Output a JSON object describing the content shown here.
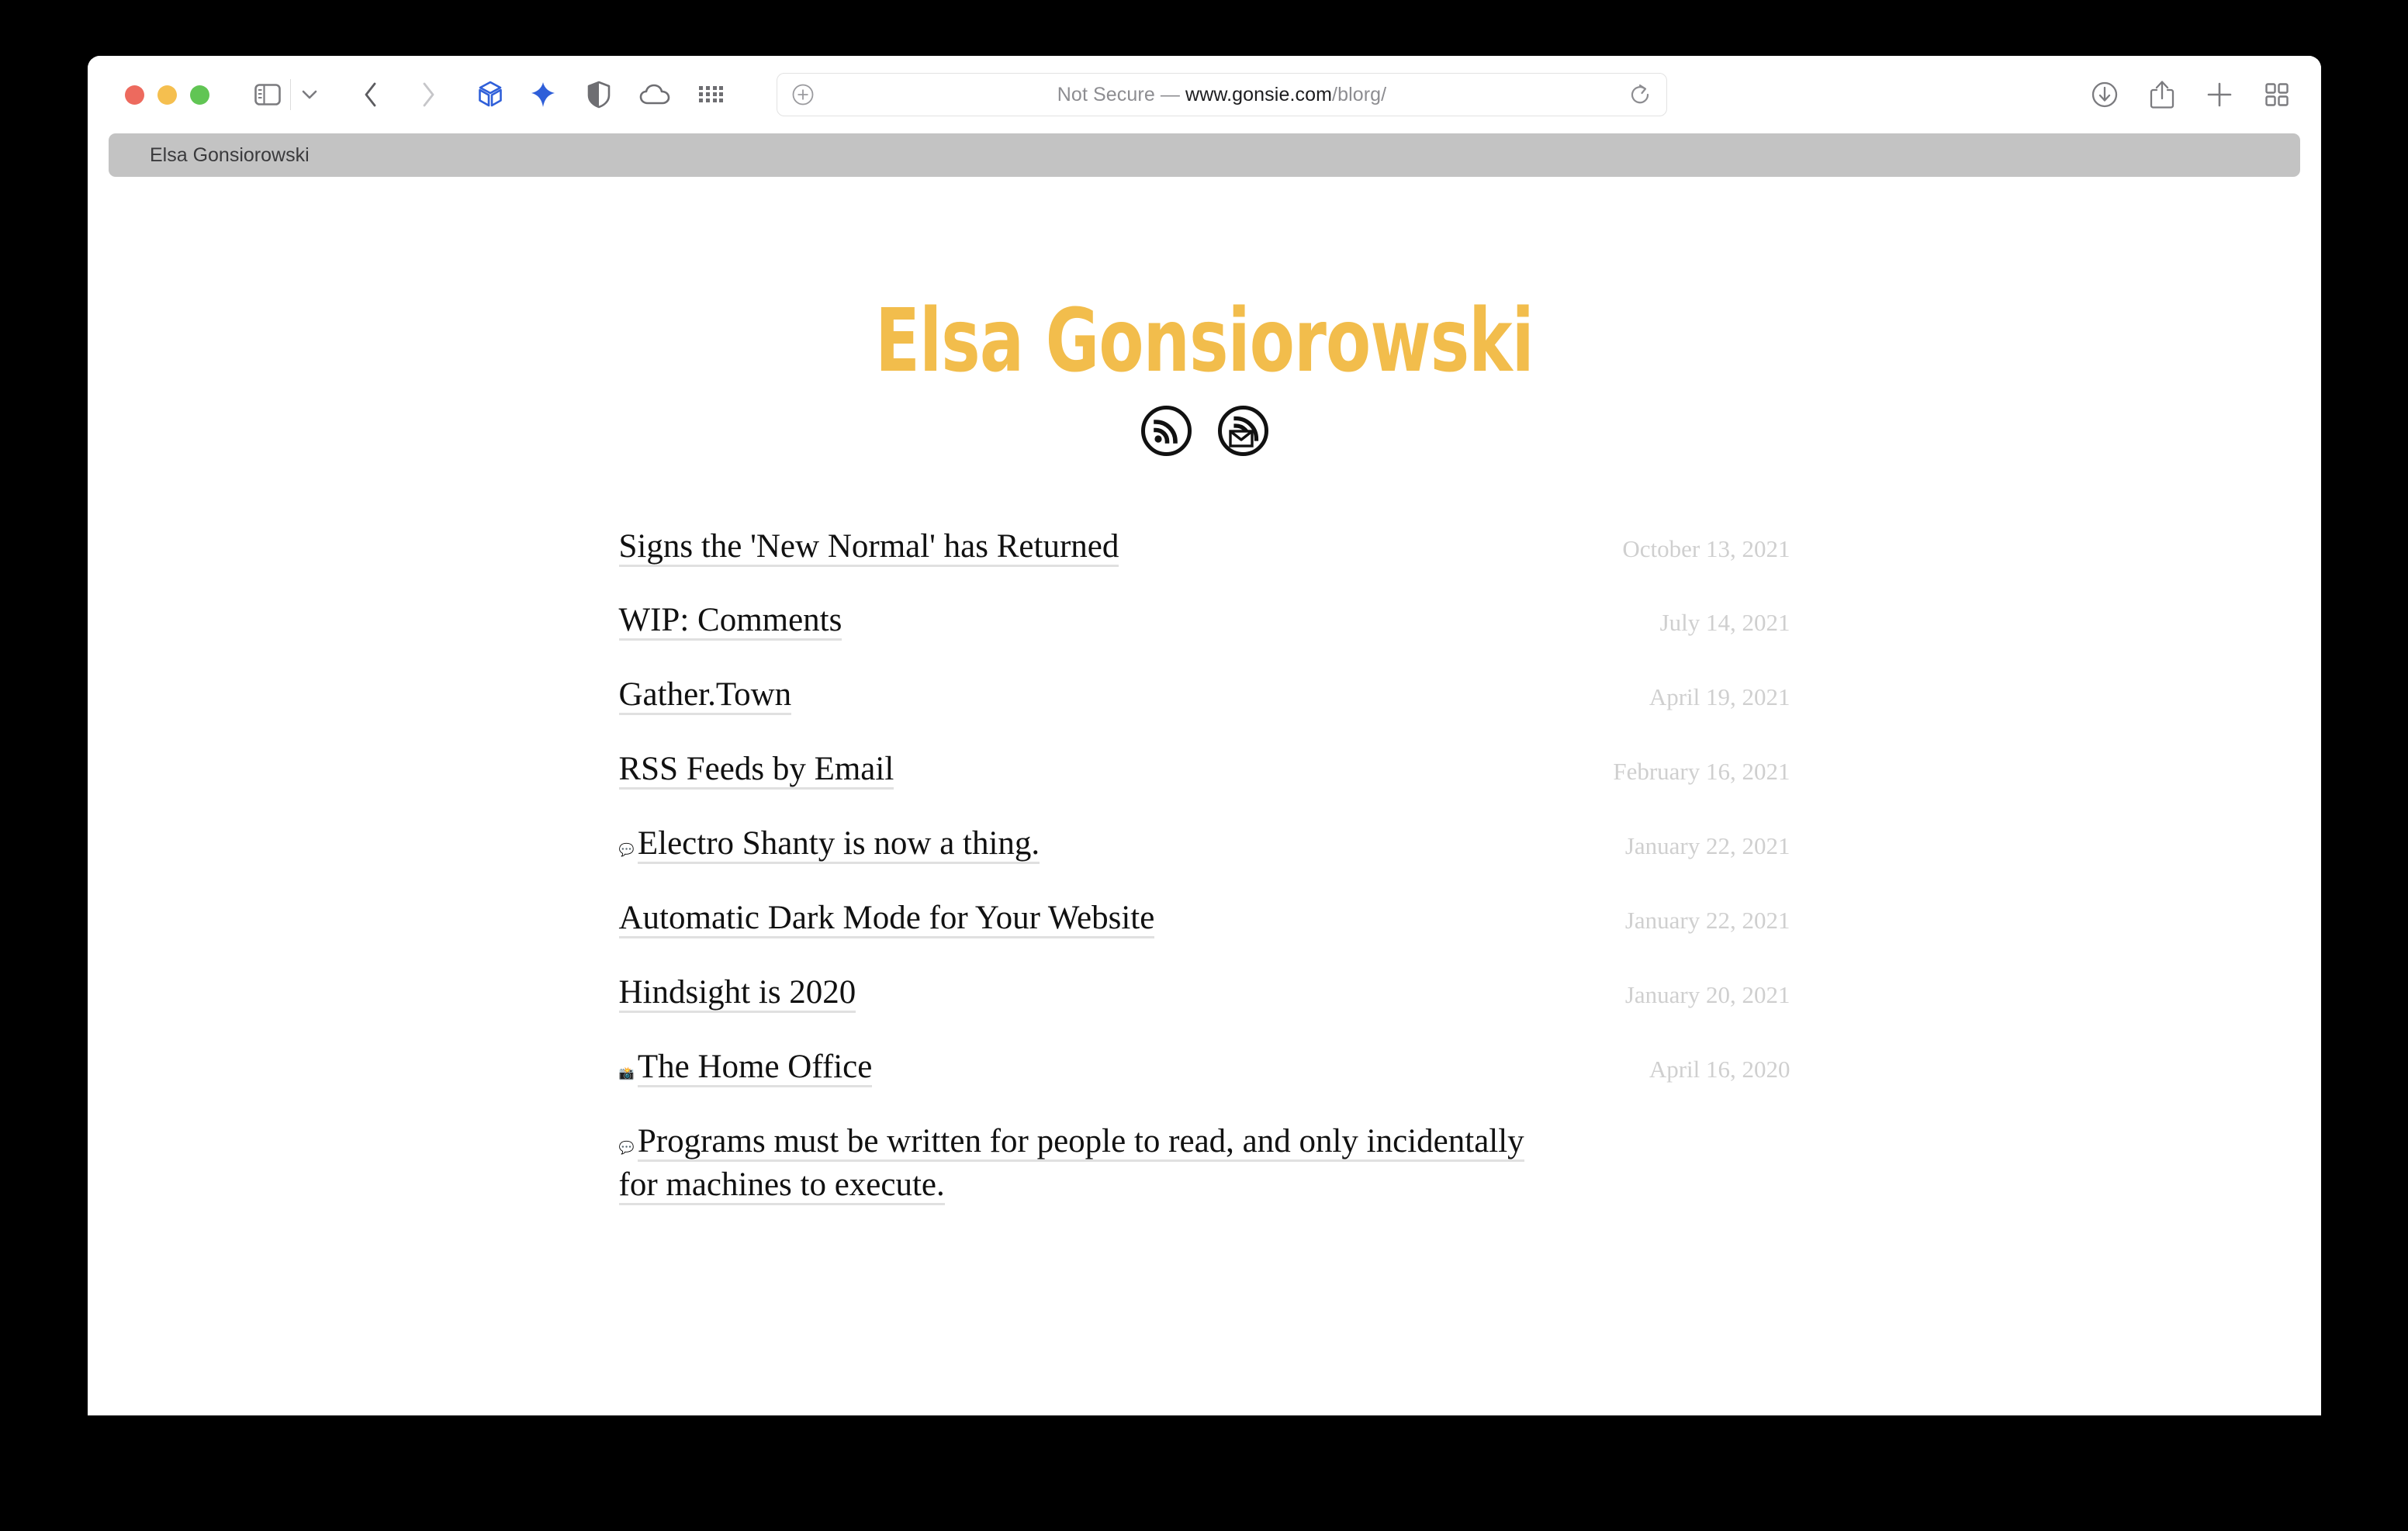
{
  "window": {
    "traffic_lights": [
      {
        "name": "close",
        "color": "#ed6a5e"
      },
      {
        "name": "minimize",
        "color": "#f5bf4f"
      },
      {
        "name": "zoom",
        "color": "#61c554"
      }
    ]
  },
  "toolbar": {
    "sidebar_label": "Sidebar",
    "sidebar_dropdown_label": "Sidebar options",
    "back_label": "Back",
    "forward_label": "Forward",
    "extension_cube_label": "Extension",
    "extension_sparkle_label": "Extension",
    "shield_label": "Privacy Report",
    "cloud_label": "iCloud",
    "grid_label": "Apps",
    "downloads_label": "Downloads",
    "share_label": "Share",
    "new_tab_label": "New Tab",
    "tab_overview_label": "Tab Overview"
  },
  "url_bar": {
    "security_status": "Not Secure",
    "separator": " — ",
    "domain": "www.gonsie.com",
    "path": "/blorg/",
    "full_text": "Not Secure — www.gonsie.com/blorg/",
    "reload_label": "Reload",
    "zoom_label": "Page Zoom"
  },
  "tab_bar": {
    "tabs": [
      {
        "title": "Elsa Gonsiorowski",
        "active": true
      }
    ]
  },
  "page": {
    "site_title": "Elsa Gonsiorowski",
    "accent_color": "#f2bd4c",
    "social_links": [
      {
        "name": "rss-icon",
        "label": "RSS Feed"
      },
      {
        "name": "rss-email-icon",
        "label": "Subscribe by Email"
      }
    ],
    "posts": [
      {
        "emoji": "",
        "title": "Signs the 'New Normal' has Returned",
        "date": "October 13, 2021"
      },
      {
        "emoji": "",
        "title": "WIP: Comments",
        "date": "July 14, 2021"
      },
      {
        "emoji": "",
        "title": "Gather.Town",
        "date": "April 19, 2021"
      },
      {
        "emoji": "",
        "title": "RSS Feeds by Email",
        "date": "February 16, 2021"
      },
      {
        "emoji": "💬",
        "title": "Electro Shanty is now a thing.",
        "date": "January 22, 2021"
      },
      {
        "emoji": "",
        "title": "Automatic Dark Mode for Your Website",
        "date": "January 22, 2021"
      },
      {
        "emoji": "",
        "title": "Hindsight is 2020",
        "date": "January 20, 2021"
      },
      {
        "emoji": "📸",
        "title": "The Home Office",
        "date": "April 16, 2020"
      },
      {
        "emoji": "💬",
        "title": "Programs must be written for people to read, and only incidentally for machines to execute.",
        "date": ""
      }
    ]
  }
}
